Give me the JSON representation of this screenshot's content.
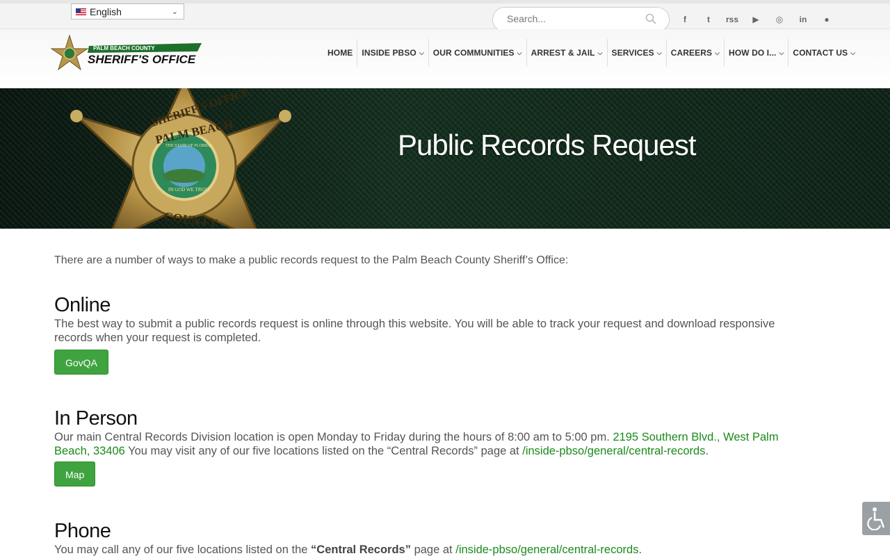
{
  "topbar": {
    "language": "English",
    "search_placeholder": "Search...",
    "social": [
      {
        "name": "facebook-icon",
        "glyph": "f"
      },
      {
        "name": "twitter-icon",
        "glyph": "t"
      },
      {
        "name": "rss-icon",
        "glyph": "rss"
      },
      {
        "name": "youtube-icon",
        "glyph": "▶"
      },
      {
        "name": "instagram-icon",
        "glyph": "◎"
      },
      {
        "name": "linkedin-icon",
        "glyph": "in"
      },
      {
        "name": "reddit-icon",
        "glyph": "●"
      }
    ]
  },
  "logo": {
    "line1": "PALM BEACH COUNTY",
    "line2": "SHERIFF'S OFFICE"
  },
  "nav": [
    {
      "label": "HOME",
      "has_dropdown": false
    },
    {
      "label": "INSIDE PBSO",
      "has_dropdown": true
    },
    {
      "label": "OUR COMMUNITIES",
      "has_dropdown": true
    },
    {
      "label": "ARREST & JAIL",
      "has_dropdown": true
    },
    {
      "label": "SERVICES",
      "has_dropdown": true
    },
    {
      "label": "CAREERS",
      "has_dropdown": true
    },
    {
      "label": "HOW DO I...",
      "has_dropdown": true
    },
    {
      "label": "CONTACT US",
      "has_dropdown": true
    }
  ],
  "banner": {
    "title": "Public Records Request",
    "badge_top": "SHERIFF'S OFFICE",
    "badge_middle": "PALM BEACH",
    "badge_bottom": "COUNTY",
    "seal_text": "THE STATE OF FLORIDA",
    "motto": "IN GOD WE TRUST"
  },
  "content": {
    "intro": "There are a number of ways to make a public records request to the Palm Beach County Sheriff’s Office:",
    "online": {
      "heading": "Online",
      "text": "The best way to submit a public records request is online through this website. You will be able to track your request and download responsive records when your request is completed.",
      "button": "GovQA"
    },
    "in_person": {
      "heading": "In Person",
      "text_before": "Our main Central Records Division location is open Monday to Friday during the hours of 8:00 am to 5:00 pm. ",
      "address_link": "2195 Southern Blvd., West Palm Beach, 33406",
      "text_middle": " You may visit any of our five locations listed on the “Central Records” page at ",
      "path_link": "/inside-pbso/general/central-records",
      "text_after": ".",
      "button": "Map"
    },
    "phone": {
      "heading": "Phone",
      "text_before": "You may call any of our five locations listed on the ",
      "bold": "“Central Records”",
      "text_middle": " page at ",
      "path_link": "/inside-pbso/general/central-records",
      "text_after": "."
    }
  },
  "colors": {
    "accent_green": "#3fa33f",
    "link_green": "#1b8a1b",
    "banner_dark": "#0f2418"
  }
}
